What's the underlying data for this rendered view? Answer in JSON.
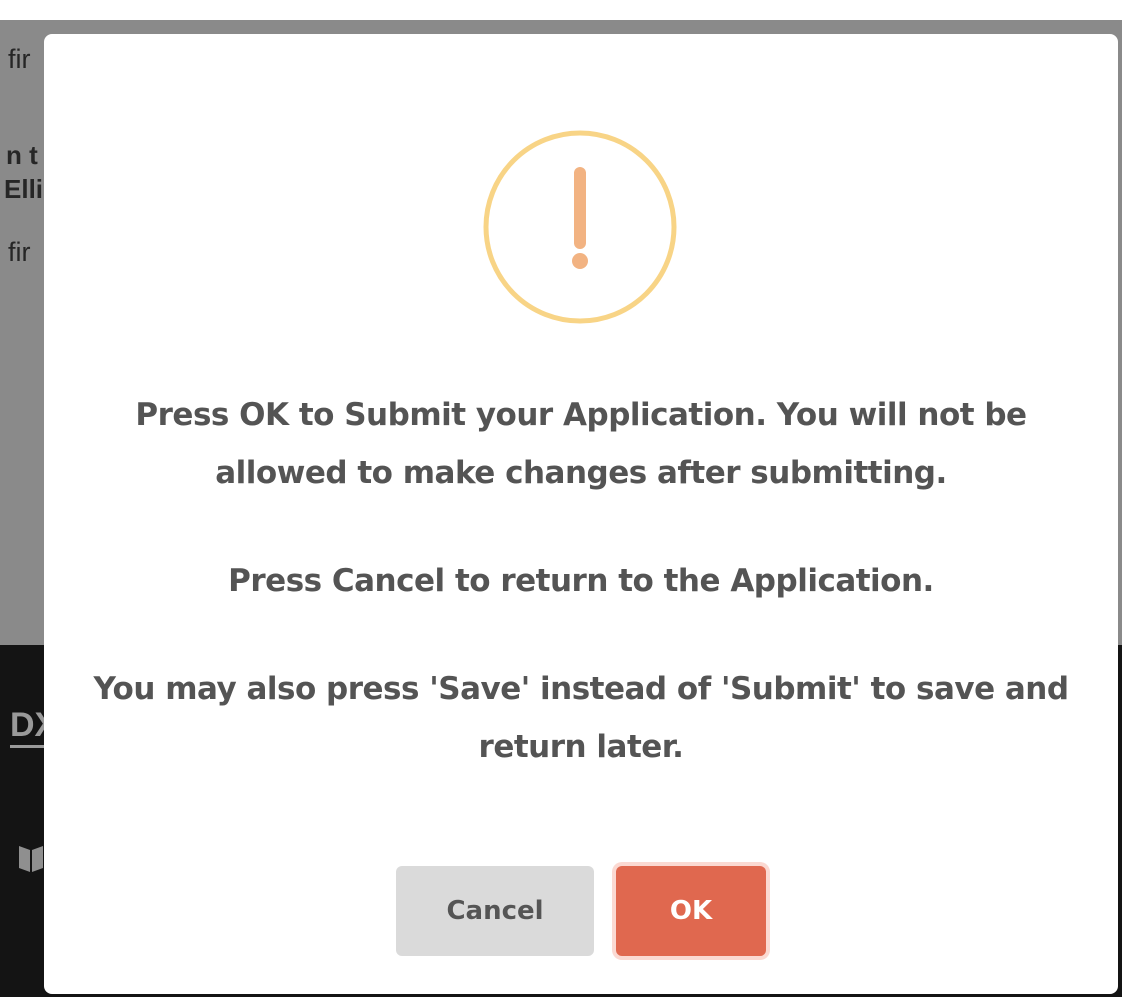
{
  "background": {
    "fragments": [
      "fir",
      "n t",
      "Elli",
      "fir",
      "DX"
    ]
  },
  "dialog": {
    "icon": "warning-exclamation-icon",
    "message_line1": "Press OK to Submit your Application. You will not be",
    "message_line2": "allowed to make changes after submitting.",
    "message_cancel": "Press Cancel to return to the Application.",
    "message_save_line1": "You may also press 'Save' instead of 'Submit' to save and",
    "message_save_line2": "return later.",
    "cancel_label": "Cancel",
    "ok_label": "OK"
  },
  "colors": {
    "warning_ring": "#f8d486",
    "warning_mark": "#f2b382",
    "ok_button": "#e0684f",
    "cancel_button": "#dadada",
    "overlay": "#8a8a8a",
    "text": "#545454"
  }
}
